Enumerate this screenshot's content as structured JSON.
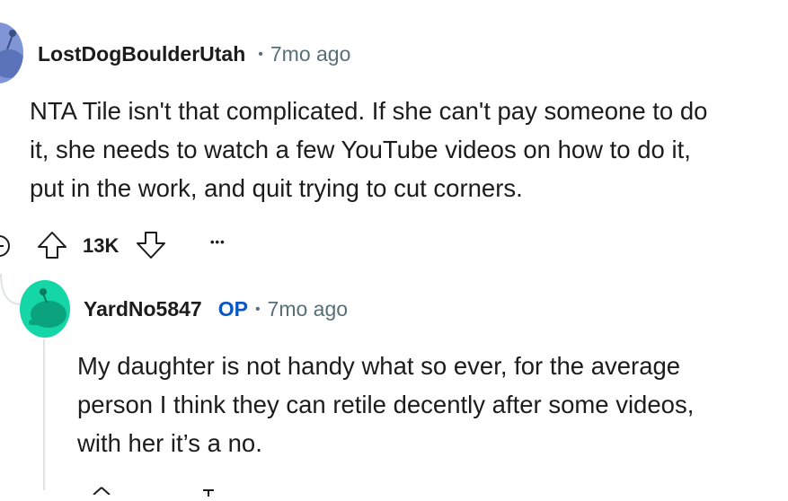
{
  "comment1": {
    "username": "LostDogBoulderUtah",
    "separator": "•",
    "time": "7mo ago",
    "body_lines": [
      "NTA Tile isn't that complicated. If she can't pay someone to do",
      "it, she needs to watch a few YouTube videos on how to do it,",
      "put in the work, and quit trying to cut corners."
    ],
    "score": "13K",
    "more_label": "•••"
  },
  "comment2": {
    "username": "YardNo5847",
    "flair": "OP",
    "separator": "•",
    "time": "7mo ago",
    "body_lines": [
      "My daughter is not handy what so ever, for the average",
      "person I think they can retile decently after some videos,",
      "with her it’s a no."
    ]
  },
  "colors": {
    "avatar1": "#7f95d6",
    "avatar2": "#15d6a6",
    "op": "#0a56c2",
    "meta": "#576f76"
  },
  "icons": [
    "avatar-icon",
    "collapse-icon",
    "upvote-icon",
    "downvote-icon",
    "more-icon"
  ]
}
